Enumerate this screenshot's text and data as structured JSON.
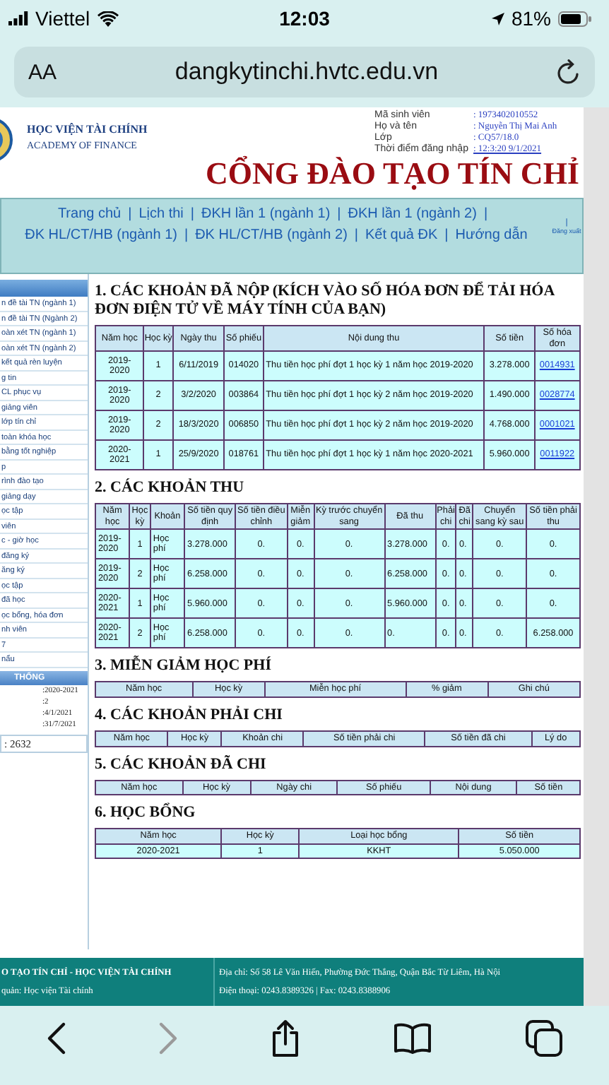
{
  "status_bar": {
    "carrier": "Viettel",
    "time": "12:03",
    "battery": "81%"
  },
  "browser": {
    "text_size": "AA",
    "url": "dangkytinchi.hvtc.edu.vn"
  },
  "header": {
    "school_name": "HỌC VIỆN TÀI CHÍNH",
    "school_name_en": "ACADEMY OF FINANCE",
    "title": "CỔNG ĐÀO TẠO TÍN CHỈ",
    "info": [
      {
        "label": "Mã sinh viên",
        "value": ": 1973402010552",
        "kind": "plain"
      },
      {
        "label": "Họ và tên",
        "value": ": Nguyễn Thị Mai Anh",
        "kind": "plain"
      },
      {
        "label": "Lớp",
        "value": ": CQ57/18.0",
        "kind": "plain"
      },
      {
        "label": "Thời điểm đăng nhập",
        "value": ": 12:3:20 9/1/2021",
        "kind": "link"
      }
    ]
  },
  "nav": {
    "separator": "|",
    "items": [
      "Trang chủ",
      "Lịch thi",
      "ĐKH lần 1 (ngành 1)",
      "ĐKH lần 1 (ngành 2)",
      "ĐK HL/CT/HB (ngành 1)",
      "ĐK HL/CT/HB (ngành 2)",
      "Kết quả ĐK",
      "Hướng dẫn"
    ],
    "logout": "Đăng xuất"
  },
  "sidebar": {
    "items": [
      "n đề tài TN (ngành 1)",
      "n đề tài TN (Ngành 2)",
      "oàn xét TN (ngành 1)",
      "oàn xét TN (ngành 2)",
      "kết quả rèn luyện",
      "g tin",
      "CL phục vụ",
      "giảng viên",
      "lớp tín chỉ",
      "toàn khóa học",
      "bằng tốt nghiệp",
      "p",
      "rình đào tạo",
      "giảng dạy",
      "ọc tập",
      "viên",
      "c - giờ học",
      "đăng ký",
      "ăng ký",
      "ọc tập",
      "đã học",
      "ọc bổng, hóa đơn",
      "nh viên",
      "7",
      "nẩu"
    ],
    "system_heading": "THỐNG",
    "system_values": [
      ":2020-2021",
      ":2",
      ":4/1/2021",
      ":31/7/2021"
    ],
    "counter": ": 2632"
  },
  "sections": [
    {
      "heading": "1. CÁC KHOẢN ĐÃ NỘP (KÍCH VÀO SỐ HÓA ĐƠN ĐỂ TẢI HÓA ĐƠN ĐIỆN TỬ VỀ MÁY TÍNH CỦA BẠN)",
      "columns": [
        {
          "label": "Năm học",
          "kind": "plain"
        },
        {
          "label": "Học kỳ",
          "kind": "plain"
        },
        {
          "label": "Ngày thu",
          "kind": "plain"
        },
        {
          "label": "Số phiếu",
          "kind": "plain"
        },
        {
          "label": "Nội dung thu",
          "kind": "text"
        },
        {
          "label": "Số tiền",
          "kind": "plain"
        },
        {
          "label": "Số hóa đơn",
          "kind": "link"
        }
      ],
      "rows": [
        [
          "2019-2020",
          "1",
          "6/11/2019",
          "014020",
          "Thu tiền học phí đợt 1 học kỳ 1 năm học 2019-2020",
          "3.278.000",
          "0014931"
        ],
        [
          "2019-2020",
          "2",
          "3/2/2020",
          "003864",
          "Thu tiền học phí đợt 1 học kỳ 2 năm học 2019-2020",
          "1.490.000",
          "0028774"
        ],
        [
          "2019-2020",
          "2",
          "18/3/2020",
          "006850",
          "Thu tiền học phí đợt 1 học kỳ 2 năm học 2019-2020",
          "4.768.000",
          "0001021"
        ],
        [
          "2020-2021",
          "1",
          "25/9/2020",
          "018761",
          "Thu tiền học phí đợt 1 học kỳ 1 năm học 2020-2021",
          "5.960.000",
          "0011922"
        ]
      ]
    },
    {
      "heading": "2. CÁC KHOẢN THU",
      "columns": [
        {
          "label": "Năm học",
          "kind": "text"
        },
        {
          "label": "Học kỳ",
          "kind": "plain"
        },
        {
          "label": "Khoản",
          "kind": "text"
        },
        {
          "label": "Số tiền quy định",
          "kind": "text"
        },
        {
          "label": "Số tiền điều chỉnh",
          "kind": "plain"
        },
        {
          "label": "Miễn giảm",
          "kind": "plain"
        },
        {
          "label": "Kỳ trước chuyển sang",
          "kind": "plain"
        },
        {
          "label": "Đã thu",
          "kind": "text"
        },
        {
          "label": "Phải chi",
          "kind": "plain"
        },
        {
          "label": "Đã chi",
          "kind": "text"
        },
        {
          "label": "Chuyển sang kỳ sau",
          "kind": "plain"
        },
        {
          "label": "Số tiền phải thu",
          "kind": "plain"
        }
      ],
      "rows": [
        [
          "2019-2020",
          "1",
          "Học phí",
          "3.278.000",
          "0.",
          "0.",
          "0.",
          "3.278.000",
          "0.",
          "0.",
          "0.",
          "0."
        ],
        [
          "2019-2020",
          "2",
          "Học phí",
          "6.258.000",
          "0.",
          "0.",
          "0.",
          "6.258.000",
          "0.",
          "0.",
          "0.",
          "0."
        ],
        [
          "2020-2021",
          "1",
          "Học phí",
          "5.960.000",
          "0.",
          "0.",
          "0.",
          "5.960.000",
          "0.",
          "0.",
          "0.",
          "0."
        ],
        [
          "2020-2021",
          "2",
          "Học phí",
          "6.258.000",
          "0.",
          "0.",
          "0.",
          "0.",
          "0.",
          "0.",
          "0.",
          "6.258.000"
        ]
      ]
    },
    {
      "heading": "3. MIỄN GIẢM HỌC PHÍ",
      "columns": [
        {
          "label": "Năm học"
        },
        {
          "label": "Học kỳ"
        },
        {
          "label": "Miễn học phí"
        },
        {
          "label": "% giảm"
        },
        {
          "label": "Ghi chú"
        }
      ]
    },
    {
      "heading": "4. CÁC KHOẢN PHẢI CHI",
      "columns": [
        {
          "label": "Năm học"
        },
        {
          "label": "Học kỳ"
        },
        {
          "label": "Khoản chi"
        },
        {
          "label": "Số tiền phải chi"
        },
        {
          "label": "Số tiền đã chi"
        },
        {
          "label": "Lý do"
        }
      ]
    },
    {
      "heading": "5. CÁC KHOẢN ĐÃ CHI",
      "columns": [
        {
          "label": "Năm học"
        },
        {
          "label": "Học kỳ"
        },
        {
          "label": "Ngày chi"
        },
        {
          "label": "Số phiếu"
        },
        {
          "label": "Nội dung"
        },
        {
          "label": "Số tiền"
        }
      ]
    },
    {
      "heading": "6. HỌC BỔNG",
      "columns": [
        {
          "label": "Năm học",
          "kind": "plain"
        },
        {
          "label": "Học kỳ",
          "kind": "plain"
        },
        {
          "label": "Loại học bổng",
          "kind": "plain"
        },
        {
          "label": "Số tiền",
          "kind": "plain"
        }
      ],
      "rows": [
        [
          "2020-2021",
          "1",
          "KKHT",
          "5.050.000"
        ]
      ]
    }
  ],
  "footer": {
    "left": [
      "O TẠO TÍN CHỈ - HỌC VIỆN TÀI CHÍNH",
      "quản: Học viện Tài chính"
    ],
    "right": [
      "Địa chỉ: Số 58 Lê Văn Hiến, Phường Đức Thắng, Quận Bắc Từ Liêm, Hà Nội",
      "Điện thoại: 0243.8389326 | Fax: 0243.8388906"
    ]
  },
  "toolbar": [
    {
      "kind": "back",
      "disabled": false
    },
    {
      "kind": "forward",
      "disabled": true
    },
    {
      "kind": "share",
      "disabled": false
    },
    {
      "kind": "bookmarks",
      "disabled": false
    },
    {
      "kind": "tabs",
      "disabled": false
    }
  ]
}
